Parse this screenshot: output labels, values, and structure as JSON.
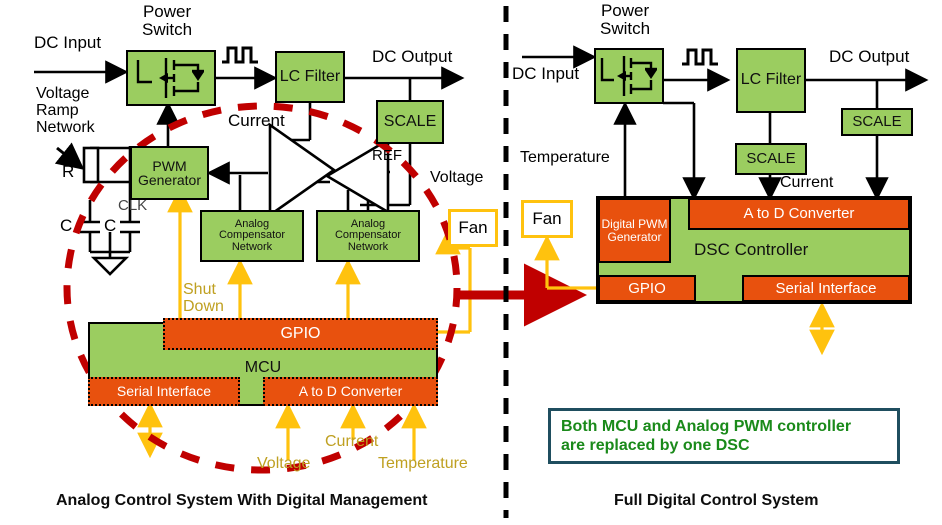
{
  "meta": {
    "colors": {
      "green_block": "#9BCD60",
      "orange_block": "#E8510E",
      "red_dashed": "#C00000",
      "gold_arrow": "#FFC20E",
      "gold_text": "#BFA021",
      "callout_border": "#1F4E5F",
      "callout_text": "#1a8a1a",
      "divider": "#000000"
    }
  },
  "left_panel": {
    "caption": "Analog Control System With Digital Management",
    "labels": {
      "dc_input": "DC Input",
      "power_switch": "Power\nSwitch",
      "dc_output": "DC Output",
      "voltage_ramp_network": "Voltage\nRamp\nNetwork",
      "r": "R",
      "c1": "C",
      "c2": "C",
      "clk": "CLK",
      "current": "Current",
      "ref": "REF",
      "voltage": "Voltage",
      "shut_down": "Shut\nDown",
      "adc_voltage": "Voltage",
      "adc_current": "Current",
      "adc_temperature": "Temperature"
    },
    "blocks": {
      "power_switch": "",
      "lc_filter": "LC\nFilter",
      "scale": "SCALE",
      "pwm_generator": "PWM\nGenerator",
      "analog_comp_1": "Analog\nCompensator\nNetwork",
      "analog_comp_2": "Analog\nCompensator\nNetwork",
      "fan": "Fan",
      "mcu": "MCU",
      "gpio": "GPIO",
      "serial_interface": "Serial Interface",
      "adc": "A to D Converter"
    }
  },
  "right_panel": {
    "caption": "Full Digital Control System",
    "labels": {
      "dc_input": "DC Input",
      "power_switch": "Power\nSwitch",
      "dc_output": "DC Output",
      "temperature": "Temperature",
      "current": "Current"
    },
    "blocks": {
      "power_switch": "",
      "lc_filter": "LC\nFilter",
      "scale_out": "SCALE",
      "scale_cur": "SCALE",
      "fan": "Fan",
      "digital_pwm_generator": "Digital\nPWM\nGenerator",
      "dsc_controller": "DSC Controller",
      "adc": "A to D Converter",
      "gpio": "GPIO",
      "serial_interface": "Serial Interface"
    },
    "callout": {
      "line1": "Both MCU and Analog PWM controller",
      "line2": "are replaced by one DSC"
    }
  }
}
